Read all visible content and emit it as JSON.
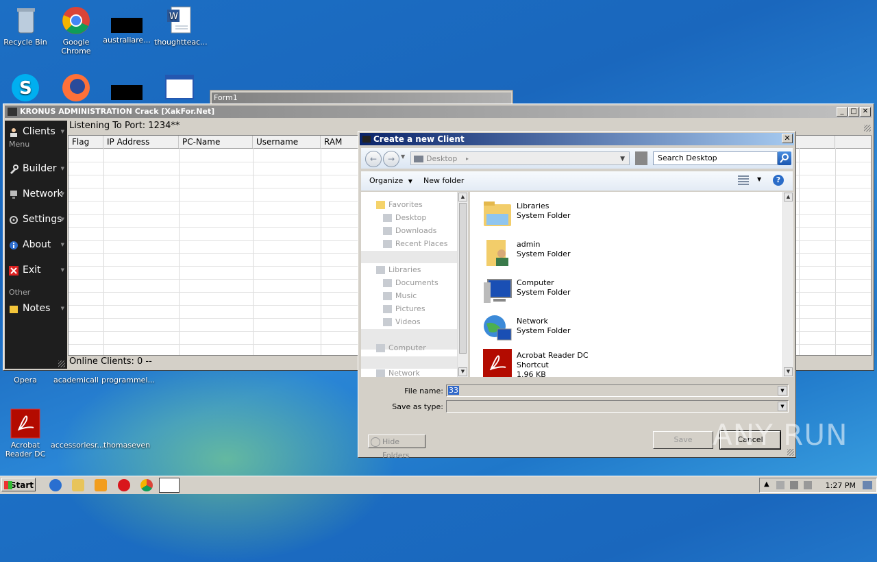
{
  "desktop": {
    "icons": [
      {
        "label": "Recycle Bin",
        "icon": "recycle-bin-icon"
      },
      {
        "label": "Google Chrome",
        "icon": "chrome-icon"
      },
      {
        "label": "australiare...",
        "icon": "black-file-icon"
      },
      {
        "label": "thoughtteac...",
        "icon": "word-doc-icon"
      },
      {
        "label": "Opera",
        "icon": "opera-icon"
      },
      {
        "label": "academicall",
        "icon": "file-icon"
      },
      {
        "label": "programmel...",
        "icon": "file-icon"
      },
      {
        "label": "Acrobat Reader DC",
        "icon": "acrobat-icon"
      },
      {
        "label": "accessoriesr...",
        "icon": "file-icon"
      },
      {
        "label": "thomaseven",
        "icon": "file-icon"
      }
    ]
  },
  "form1": {
    "title": "Form1"
  },
  "kronus": {
    "title": "KRONUS ADMINISTRATION Crack [XakFor.Net]",
    "listening": "Listening To Port:  1234**",
    "status": "Online Clients: 0 --",
    "sidebar": {
      "items": [
        {
          "label": "Clients"
        },
        {
          "label": "Builder"
        },
        {
          "label": "Network"
        },
        {
          "label": "Settings"
        },
        {
          "label": "About"
        },
        {
          "label": "Exit"
        },
        {
          "label": "Notes"
        }
      ],
      "section_menu": "Menu",
      "section_other": "Other"
    },
    "columns": [
      "Flag",
      "IP Address",
      "PC-Name",
      "Username",
      "RAM"
    ]
  },
  "dialog": {
    "title": "Create a new Client",
    "address": "Desktop",
    "search_placeholder": "Search Desktop",
    "organize": "Organize",
    "new_folder": "New folder",
    "nav": {
      "favorites": "Favorites",
      "fav_items": [
        "Desktop",
        "Downloads",
        "Recent Places"
      ],
      "libraries": "Libraries",
      "lib_items": [
        "Documents",
        "Music",
        "Pictures",
        "Videos"
      ],
      "computer": "Computer",
      "network": "Network"
    },
    "files": [
      {
        "name": "Libraries",
        "type": "System Folder"
      },
      {
        "name": "admin",
        "type": "System Folder"
      },
      {
        "name": "Computer",
        "type": "System Folder"
      },
      {
        "name": "Network",
        "type": "System Folder"
      },
      {
        "name": "Acrobat Reader DC",
        "type": "Shortcut",
        "size": "1.96 KB"
      }
    ],
    "file_name_label": "File name:",
    "file_name_value": "33",
    "save_type_label": "Save as type:",
    "hide_folders": "Hide Folders",
    "save": "Save",
    "cancel": "Cancel"
  },
  "taskbar": {
    "start": "Start",
    "clock": "1:27 PM"
  },
  "watermark": "ANY RUN"
}
